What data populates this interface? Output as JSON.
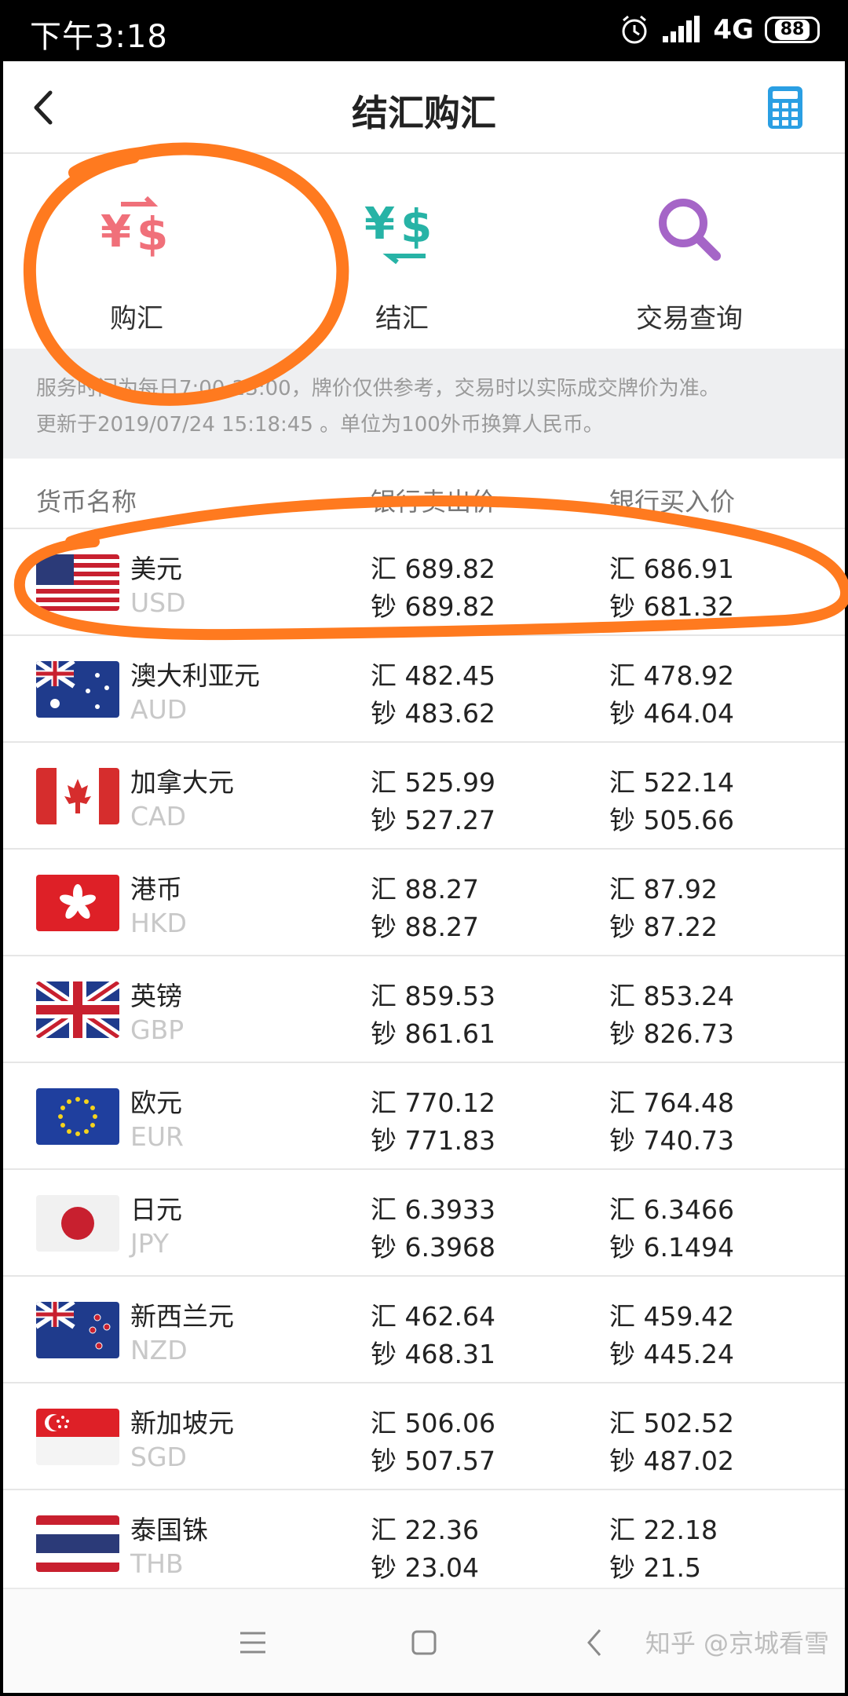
{
  "status_bar": {
    "time": "下午3:18",
    "network": "4G",
    "battery": "88"
  },
  "header": {
    "title": "结汇购汇",
    "back_icon": "chevron-left-icon",
    "calculator_icon": "calculator-icon"
  },
  "quick_actions": [
    {
      "label": "购汇",
      "icon": "buy-fx-icon",
      "color": "#f0707a"
    },
    {
      "label": "结汇",
      "icon": "settle-fx-icon",
      "color": "#27b3a6"
    },
    {
      "label": "交易查询",
      "icon": "search-icon",
      "color": "#a565c7"
    }
  ],
  "notice": {
    "line1": "服务时间为每日7:00-23:00，牌价仅供参考，交易时以实际成交牌价为准。",
    "line2": "更新于2019/07/24 15:18:45 。单位为100外币换算人民币。"
  },
  "table": {
    "headers": {
      "name": "货币名称",
      "sell": "银行卖出价",
      "buy": "银行买入价"
    },
    "rows": [
      {
        "name": "美元",
        "code": "USD",
        "flag": "us",
        "sell_h": "汇 689.82",
        "sell_c": "钞 689.82",
        "buy_h": "汇 686.91",
        "buy_c": "钞 681.32"
      },
      {
        "name": "澳大利亚元",
        "code": "AUD",
        "flag": "au",
        "sell_h": "汇 482.45",
        "sell_c": "钞 483.62",
        "buy_h": "汇 478.92",
        "buy_c": "钞 464.04"
      },
      {
        "name": "加拿大元",
        "code": "CAD",
        "flag": "ca",
        "sell_h": "汇 525.99",
        "sell_c": "钞 527.27",
        "buy_h": "汇 522.14",
        "buy_c": "钞 505.66"
      },
      {
        "name": "港币",
        "code": "HKD",
        "flag": "hk",
        "sell_h": "汇 88.27",
        "sell_c": "钞 88.27",
        "buy_h": "汇 87.92",
        "buy_c": "钞 87.22"
      },
      {
        "name": "英镑",
        "code": "GBP",
        "flag": "gb",
        "sell_h": "汇 859.53",
        "sell_c": "钞 861.61",
        "buy_h": "汇 853.24",
        "buy_c": "钞 826.73"
      },
      {
        "name": "欧元",
        "code": "EUR",
        "flag": "eu",
        "sell_h": "汇 770.12",
        "sell_c": "钞 771.83",
        "buy_h": "汇 764.48",
        "buy_c": "钞 740.73"
      },
      {
        "name": "日元",
        "code": "JPY",
        "flag": "jp",
        "sell_h": "汇 6.3933",
        "sell_c": "钞 6.3968",
        "buy_h": "汇 6.3466",
        "buy_c": "钞 6.1494"
      },
      {
        "name": "新西兰元",
        "code": "NZD",
        "flag": "nz",
        "sell_h": "汇 462.64",
        "sell_c": "钞 468.31",
        "buy_h": "汇 459.42",
        "buy_c": "钞 445.24"
      },
      {
        "name": "新加坡元",
        "code": "SGD",
        "flag": "sg",
        "sell_h": "汇 506.06",
        "sell_c": "钞 507.57",
        "buy_h": "汇 502.52",
        "buy_c": "钞 487.02"
      },
      {
        "name": "泰国铢",
        "code": "THB",
        "flag": "th",
        "sell_h": "汇 22.36",
        "sell_c": "钞 23.04",
        "buy_h": "汇 22.18",
        "buy_c": "钞 21.5"
      }
    ]
  },
  "nav_bar": {
    "menu_icon": "menu-icon",
    "home_icon": "home-icon",
    "back_icon": "back-icon"
  },
  "watermark": "知乎 @京城看雪",
  "annotation_color": "#ff7a1f"
}
